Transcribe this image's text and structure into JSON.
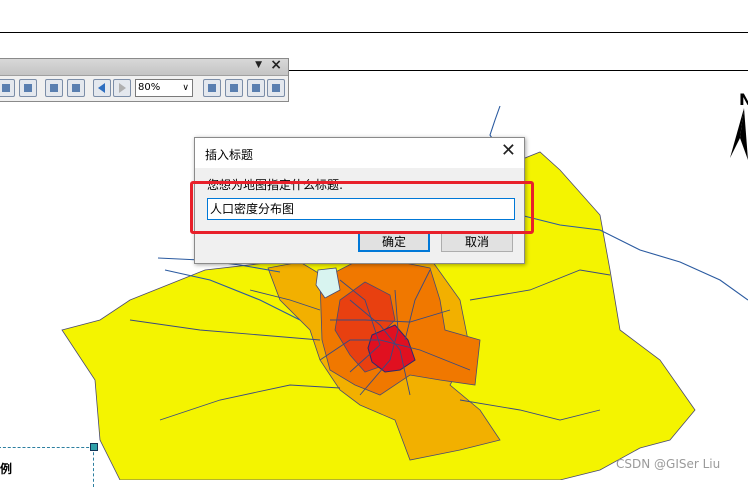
{
  "toolbar": {
    "zoom_value": "80%"
  },
  "dialog": {
    "title": "插入标题",
    "prompt": "您想为地图指定什么标题:",
    "input_value": "人口密度分布图",
    "ok_label": "确定",
    "cancel_label": "取消"
  },
  "legend": {
    "partial_title": "例"
  },
  "north_arrow": {
    "label": "N"
  },
  "watermark": "CSDN @GISer Liu",
  "colors": {
    "low": "#f4f400",
    "mid": "#f2b000",
    "high": "#f07800",
    "very_high": "#e84010",
    "max": "#e01020",
    "water": "#2a5aa0",
    "highlight": "#e8202a"
  }
}
